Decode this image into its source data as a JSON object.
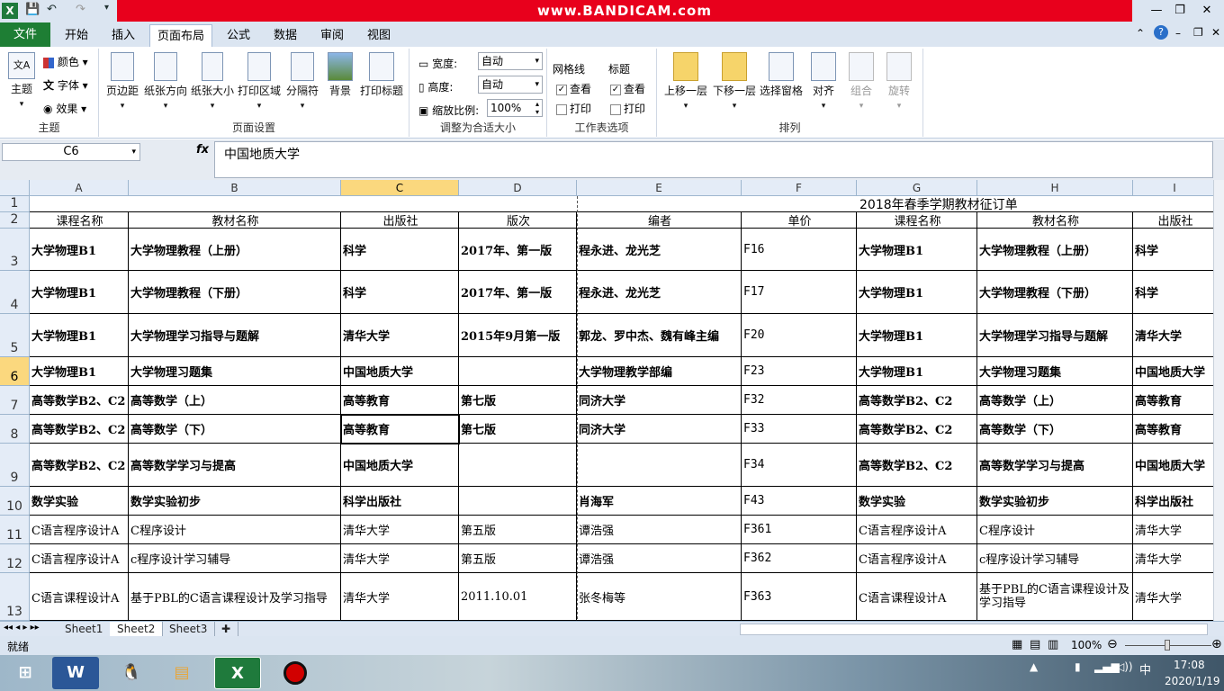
{
  "titlebar": {
    "title": "www.BANDICAM.com",
    "quick_undo": "↶",
    "quick_redo": "↷",
    "save": "💾"
  },
  "tabs": [
    "文件",
    "开始",
    "插入",
    "页面布局",
    "公式",
    "数据",
    "审阅",
    "视图"
  ],
  "ribbon": {
    "theme": {
      "big": "主题",
      "colors": "颜色",
      "fonts": "字体",
      "effects": "效果",
      "label": "主题"
    },
    "page_setup": {
      "margins": "页边距",
      "orientation": "纸张方向",
      "size": "纸张大小",
      "print_area": "打印区域",
      "breaks": "分隔符",
      "background": "背景",
      "print_titles": "打印标题",
      "label": "页面设置"
    },
    "scale": {
      "width_label": "宽度:",
      "width_value": "自动",
      "height_label": "高度:",
      "height_value": "自动",
      "scale_label": "缩放比例:",
      "scale_value": "100%",
      "label": "调整为合适大小"
    },
    "sheet_options": {
      "gridlines": "网格线",
      "headings": "标题",
      "view": "查看",
      "print": "打印",
      "label": "工作表选项"
    },
    "arrange": {
      "forward": "上移一层",
      "backward": "下移一层",
      "selection_pane": "选择窗格",
      "align": "对齐",
      "group": "组合",
      "rotate": "旋转",
      "label": "排列"
    }
  },
  "formula_bar": {
    "name_box": "C6",
    "fx": "fx",
    "content": "中国地质大学"
  },
  "columns": [
    "A",
    "B",
    "C",
    "D",
    "E",
    "F",
    "G",
    "H",
    "I"
  ],
  "row_numbers": [
    "1",
    "2",
    "3",
    "4",
    "5",
    "6",
    "7",
    "8",
    "9",
    "10",
    "11",
    "12",
    "13"
  ],
  "sheet_title": "2018年春季学期教材征订单",
  "header_row": [
    "课程名称",
    "教材名称",
    "出版社",
    "版次",
    "编者",
    "单价",
    "课程名称",
    "教材名称",
    "出版社"
  ],
  "rows": [
    [
      "大学物理B1",
      "大学物理教程（上册）",
      "科学",
      "2017年、第一版",
      "程永进、龙光芝",
      "F16",
      "大学物理B1",
      "大学物理教程（上册）",
      "科学"
    ],
    [
      "大学物理B1",
      "大学物理教程（下册）",
      "科学",
      "2017年、第一版",
      "程永进、龙光芝",
      "F17",
      "大学物理B1",
      "大学物理教程（下册）",
      "科学"
    ],
    [
      "大学物理B1",
      "大学物理学习指导与题解",
      "清华大学",
      "2015年9月第一版",
      "郭龙、罗中杰、魏有峰主编",
      "F20",
      "大学物理B1",
      "大学物理学习指导与题解",
      "清华大学"
    ],
    [
      "大学物理B1",
      "大学物理习题集",
      "中国地质大学",
      "",
      "大学物理教学部编",
      "F23",
      "大学物理B1",
      "大学物理习题集",
      "中国地质大学"
    ],
    [
      "高等数学B2、C2",
      "高等数学（上）",
      "高等教育",
      "第七版",
      "同济大学",
      "F32",
      "高等数学B2、C2",
      "高等数学（上）",
      "高等教育"
    ],
    [
      "高等数学B2、C2",
      "高等数学（下）",
      "高等教育",
      "第七版",
      "同济大学",
      "F33",
      "高等数学B2、C2",
      "高等数学（下）",
      "高等教育"
    ],
    [
      "高等数学B2、C2",
      "高等数学学习与提高",
      "中国地质大学",
      "",
      "",
      "F34",
      "高等数学B2、C2",
      "高等数学学习与提高",
      "中国地质大学"
    ],
    [
      "数学实验",
      "数学实验初步",
      "科学出版社",
      "",
      "肖海军",
      "F43",
      "数学实验",
      "数学实验初步",
      "科学出版社"
    ],
    [
      "C语言程序设计A",
      "C程序设计",
      "清华大学",
      "第五版",
      "谭浩强",
      "F361",
      "C语言程序设计A",
      "C程序设计",
      "清华大学"
    ],
    [
      "C语言程序设计A",
      "c程序设计学习辅导",
      "清华大学",
      "第五版",
      "谭浩强",
      "F362",
      "C语言程序设计A",
      "c程序设计学习辅导",
      "清华大学"
    ],
    [
      "C语言课程设计A",
      "基于PBL的C语言课程设计及学习指导",
      "清华大学",
      "2011.10.01",
      "张冬梅等",
      "F363",
      "C语言课程设计A",
      "基于PBL的C语言课程设计及学习指导",
      "清华大学"
    ]
  ],
  "sheets": [
    "Sheet1",
    "Sheet2",
    "Sheet3"
  ],
  "status": {
    "ready": "就绪",
    "zoom": "100%"
  },
  "taskbar": {
    "time": "17:08",
    "date": "2020/1/19",
    "ime": "中"
  }
}
